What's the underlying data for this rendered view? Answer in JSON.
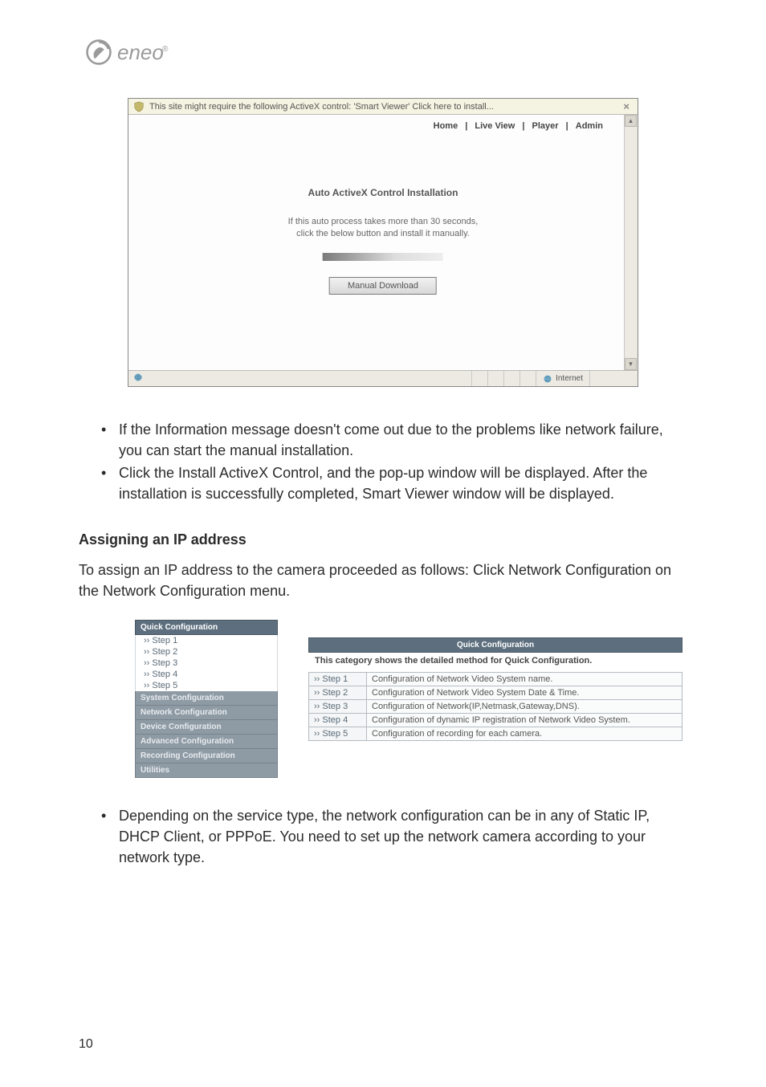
{
  "logo_text": "eneo",
  "figure1": {
    "infobar_text": "This site might require the following ActiveX control: 'Smart Viewer' Click here to install...",
    "tabs": {
      "home": "Home",
      "live": "Live View",
      "player": "Player",
      "admin": "Admin",
      "sep": "|"
    },
    "heading": "Auto ActiveX Control Installation",
    "msg_line1": "If this auto process takes more than 30 seconds,",
    "msg_line2": "click the below button and install it manually.",
    "download_btn": "Manual Download",
    "status_internet": "Internet"
  },
  "bullets1": {
    "a": "If the Information message doesn't come out due to the problems like network failure, you can start the manual installation.",
    "b": "Click the Install ActiveX Control, and the pop-up window will be displayed. After the installation is successfully completed, Smart Viewer window will be displayed."
  },
  "heading2": "Assigning an IP address",
  "para1": "To assign an IP address to the camera proceeded as follows: Click Network Configuration on the Network Configuration menu.",
  "sidebar": {
    "quick": "Quick Configuration",
    "steps": {
      "s1": "›› Step 1",
      "s2": "›› Step 2",
      "s3": "›› Step 3",
      "s4": "›› Step 4",
      "s5": "›› Step 5"
    },
    "system": "System Configuration",
    "network": "Network Configuration",
    "device": "Device Configuration",
    "advanced": "Advanced Configuration",
    "recording": "Recording Configuration",
    "utilities": "Utilities"
  },
  "qc": {
    "title": "Quick Configuration",
    "caption": "This category shows the detailed method for Quick Configuration.",
    "rows": {
      "r1s": "›› Step 1",
      "r1d": "Configuration of Network Video System name.",
      "r2s": "›› Step 2",
      "r2d": "Configuration of Network Video System Date & Time.",
      "r3s": "›› Step 3",
      "r3d": "Configuration of Network(IP,Netmask,Gateway,DNS).",
      "r4s": "›› Step 4",
      "r4d": "Configuration of dynamic IP registration of Network Video System.",
      "r5s": "›› Step 5",
      "r5d": "Configuration of recording for each camera."
    }
  },
  "bullets2": {
    "a": "Depending on the service type, the network configuration can be in any of Static IP, DHCP Client, or PPPoE. You need to set up the network camera according to your network type."
  },
  "page_number": "10"
}
